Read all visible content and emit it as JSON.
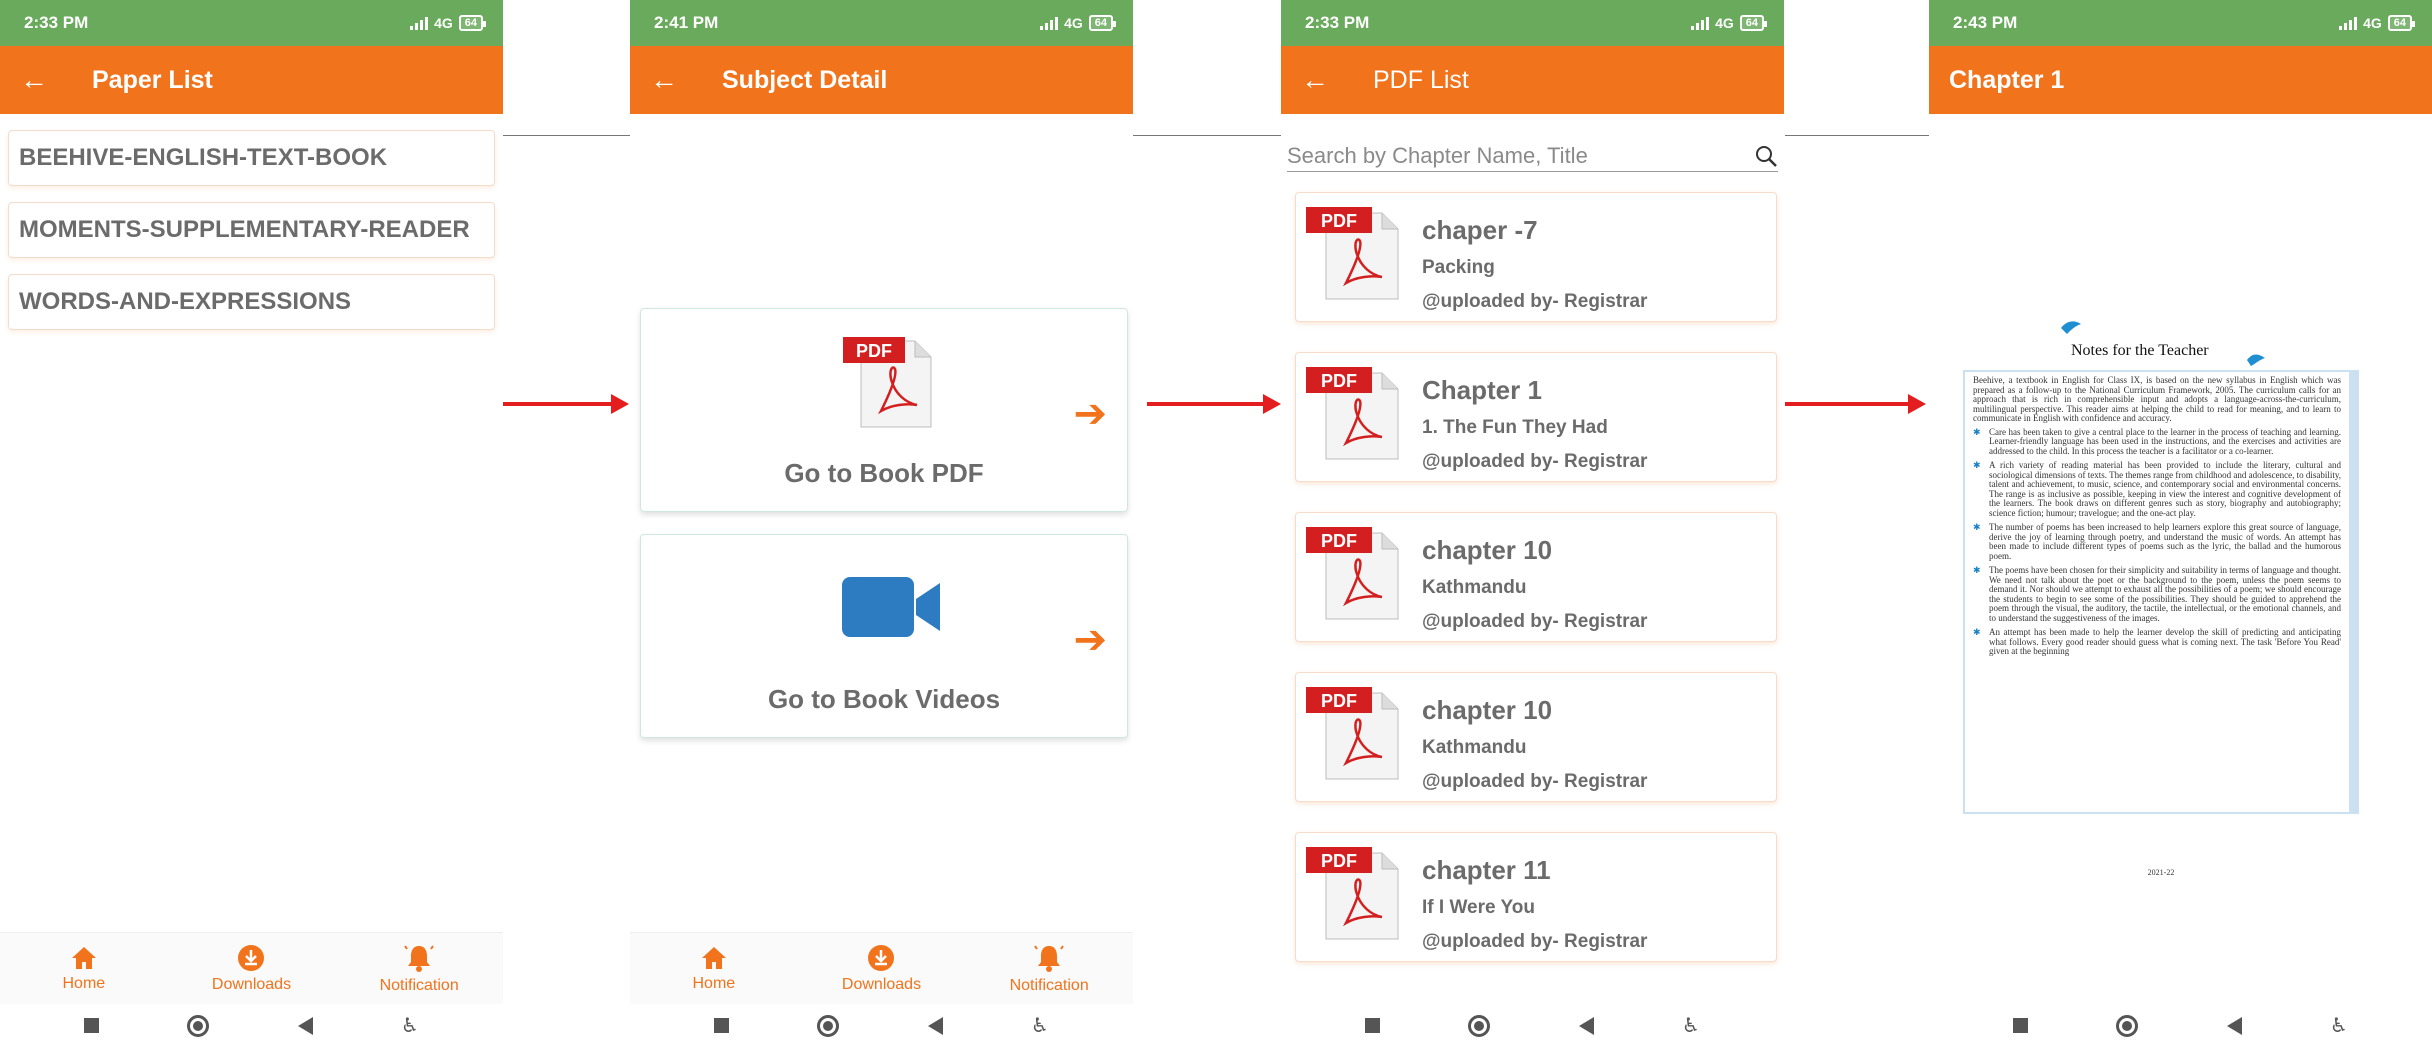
{
  "common": {
    "network": "4G",
    "battery": "64",
    "nav": {
      "home": "Home",
      "downloads": "Downloads",
      "notification": "Notification"
    },
    "back_glyph": "←",
    "accent_color": "#f1731c",
    "status_color": "#6aaa5c"
  },
  "screen1": {
    "time": "2:33 PM",
    "title": "Paper List",
    "papers": [
      "BEEHIVE-ENGLISH-TEXT-BOOK",
      "MOMENTS-SUPPLEMENTARY-READER",
      "WORDS-AND-EXPRESSIONS"
    ]
  },
  "screen2": {
    "time": "2:41 PM",
    "title": "Subject Detail",
    "pdf_label": "Go to Book PDF",
    "video_label": "Go to Book Videos",
    "arrow_glyph": "➔"
  },
  "screen3": {
    "time": "2:33 PM",
    "title": "PDF List",
    "search_placeholder": "Search by Chapter Name, Title",
    "items": [
      {
        "title": "chaper -7",
        "subtitle": "Packing",
        "uploader": "@uploaded by- Registrar"
      },
      {
        "title": "Chapter 1",
        "subtitle": "1. The Fun They Had",
        "uploader": "@uploaded by- Registrar"
      },
      {
        "title": "chapter 10",
        "subtitle": "Kathmandu",
        "uploader": "@uploaded by- Registrar"
      },
      {
        "title": "chapter 10",
        "subtitle": "Kathmandu",
        "uploader": "@uploaded by- Registrar"
      },
      {
        "title": "chapter 11",
        "subtitle": "If I Were You",
        "uploader": "@uploaded by- Registrar"
      }
    ]
  },
  "screen4": {
    "time": "2:43 PM",
    "title": "Chapter 1",
    "page": {
      "heading": "Notes for the Teacher",
      "intro": "Beehive, a textbook in English for Class IX, is based on the new syllabus in English which was prepared as a follow-up to the National Curriculum Framework, 2005. The curriculum calls for an approach that is rich in comprehensible input and adopts a language-across-the-curriculum, multilingual perspective. This reader aims at helping the child to read for meaning, and to learn to communicate in English with confidence and accuracy.",
      "bullets": [
        "Care has been taken to give a central place to the learner in the process of teaching and learning. Learner-friendly language has been used in the instructions, and the exercises and activities are addressed to the child. In this process the teacher is a facilitator or a co-learner.",
        "A rich variety of reading material has been provided to include the literary, cultural and sociological dimensions of texts. The themes range from childhood and adolescence, to disability, talent and achievement, to music, science, and contemporary social and environmental concerns. The range is as inclusive as possible, keeping in view the interest and cognitive development of the learners. The book draws on different genres such as story, biography and autobiography; science fiction; humour; travelogue; and the one-act play.",
        "The number of poems has been increased to help learners explore this great source of language, derive the joy of learning through poetry, and understand the music of words. An attempt has been made to include different types of poems such as the lyric, the ballad and the humorous poem.",
        "The poems have been chosen for their simplicity and suitability in terms of language and thought. We need not talk about the poet or the background to the poem, unless the poem seems to demand it. Nor should we attempt to exhaust all the possibilities of a poem; we should encourage the students to begin to see some of the possibilities. They should be guided to apprehend the poem through the visual, the auditory, the tactile, the intellectual, or the emotional channels, and to understand the suggestiveness of the images.",
        "An attempt has been made to help the learner develop the skill of predicting and anticipating what follows. Every good reader should guess what is coming next. The task 'Before You Read' given at the beginning"
      ],
      "footer": "2021-22"
    }
  }
}
